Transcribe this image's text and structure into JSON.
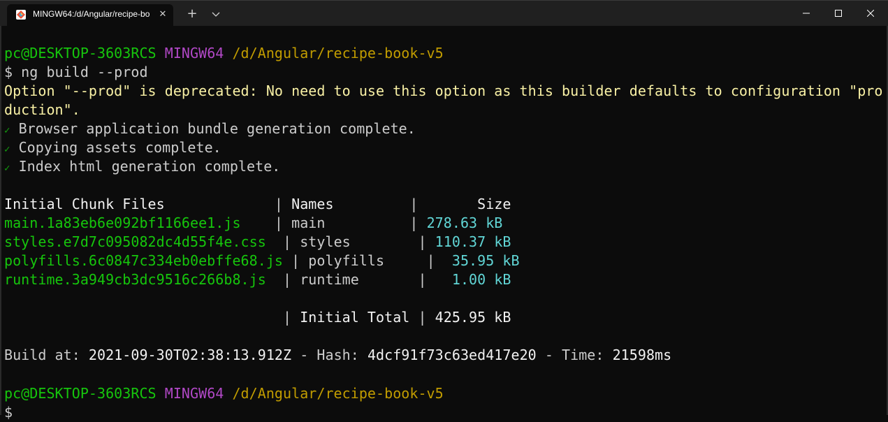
{
  "window": {
    "tab_title": "MINGW64:/d/Angular/recipe-bo",
    "tab_close": "✕",
    "new_tab": "+",
    "minimize_icon": "minimize-icon",
    "maximize_icon": "maximize-icon",
    "close_icon": "close-icon"
  },
  "terminal": {
    "prompt1": {
      "user_host": "pc@DESKTOP-3603RCS",
      "shell": "MINGW64",
      "path": "/d/Angular/recipe-book-v5"
    },
    "command": "$ ng build --prod",
    "warning_line1": "Option \"--prod\" is deprecated: No need to use this option as this builder defaults to configuration \"pro",
    "warning_line2": "duction\".",
    "checks": [
      {
        "mark": "✓",
        "text": " Browser application bundle generation complete."
      },
      {
        "mark": "✓",
        "text": " Copying assets complete."
      },
      {
        "mark": "✓",
        "text": " Index html generation complete."
      }
    ],
    "table": {
      "header": {
        "files": "Initial Chunk Files",
        "names": "Names",
        "size": "Size"
      },
      "rows": [
        {
          "file": "main.1a83eb6e092bf1166ee1.js",
          "name": "main",
          "size": "278.63",
          "unit": "kB"
        },
        {
          "file": "styles.e7d7c095082dc4d55f4e.css",
          "name": "styles",
          "size": "110.37",
          "unit": "kB"
        },
        {
          "file": "polyfills.6c0847c334eb0ebffe68.js",
          "name": "polyfills",
          "size": "35.95",
          "unit": "kB"
        },
        {
          "file": "runtime.3a949cb3dc9516c266b8.js",
          "name": "runtime",
          "size": "1.00",
          "unit": "kB"
        }
      ],
      "total_label": "Initial Total",
      "total_value": "425.95 kB"
    },
    "build": {
      "build_label": "Build at: ",
      "build_time": "2021-09-30T02:38:13.912Z",
      "hash_label": " - Hash: ",
      "hash": "4dcf91f73c63ed417e20",
      "time_label": " - Time: ",
      "time": "21598ms"
    },
    "prompt2": {
      "user_host": "pc@DESKTOP-3603RCS",
      "shell": "MINGW64",
      "path": "/d/Angular/recipe-book-v5"
    },
    "cursor_prompt": "$"
  }
}
